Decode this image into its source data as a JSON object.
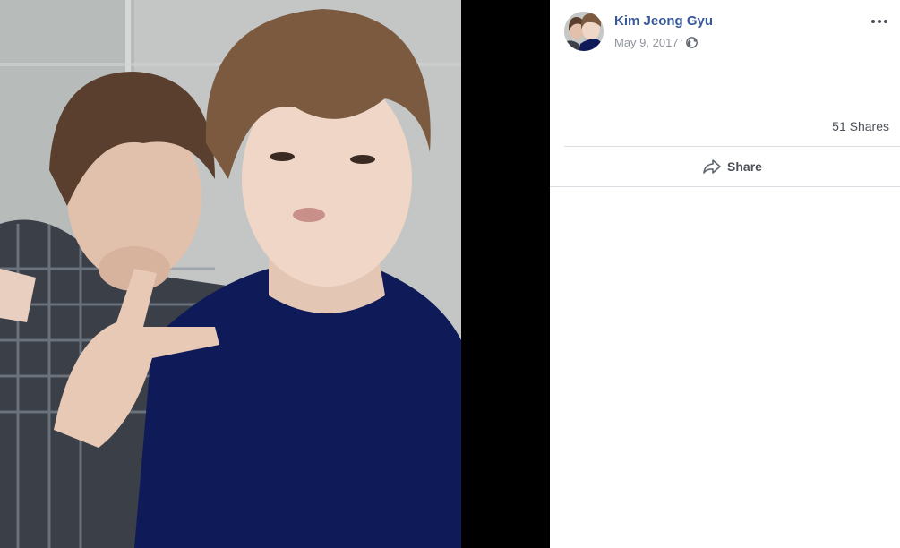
{
  "post": {
    "author_name": "Kim Jeong Gyu",
    "date": "May 9, 2017",
    "separator": "·",
    "privacy_icon": "globe-icon",
    "more_icon": "more-options-icon"
  },
  "stats": {
    "shares_label": "51 Shares"
  },
  "actions": {
    "share_label": "Share",
    "share_icon": "share-arrow-icon"
  },
  "colors": {
    "author_link": "#385898",
    "meta_text": "#90949c",
    "action_text": "#4b4f56",
    "divider": "#dadde1",
    "photo_background": "#000000"
  }
}
